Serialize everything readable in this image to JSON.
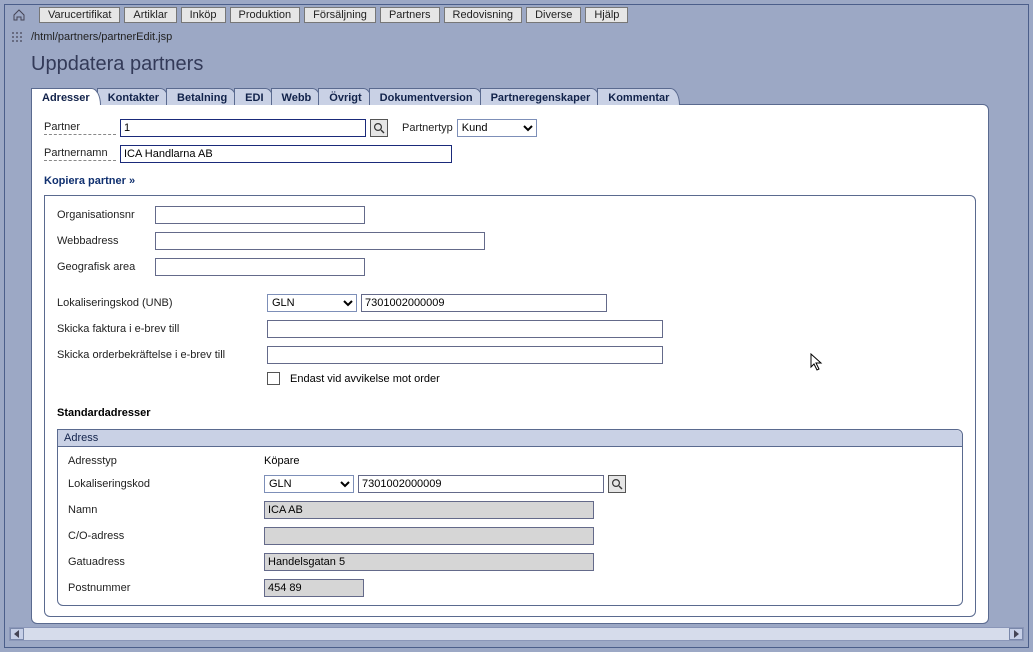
{
  "menu": {
    "items": [
      "Varucertifikat",
      "Artiklar",
      "Inköp",
      "Produktion",
      "Försäljning",
      "Partners",
      "Redovisning",
      "Diverse",
      "Hjälp"
    ]
  },
  "breadcrumb": "/html/partners/partnerEdit.jsp",
  "page_title": "Uppdatera partners",
  "tabs": [
    "Adresser",
    "Kontakter",
    "Betalning",
    "EDI",
    "Webb",
    "Övrigt",
    "Dokumentversion",
    "Partneregenskaper",
    "Kommentar"
  ],
  "active_tab": 0,
  "partner_block": {
    "partner_label": "Partner",
    "partner_value": "1",
    "partnertype_label": "Partnertyp",
    "partnertype_value": "Kund",
    "partnername_label": "Partnernamn",
    "partnername_value": "ICA Handlarna AB",
    "copy_link": "Kopiera partner »"
  },
  "details": {
    "orgnr_label": "Organisationsnr",
    "orgnr_value": "",
    "web_label": "Webbadress",
    "web_value": "",
    "geo_label": "Geografisk area",
    "geo_value": "",
    "unb_label": "Lokaliseringskod (UNB)",
    "unb_type": "GLN",
    "unb_value": "7301002000009",
    "invoice_email_label": "Skicka faktura i e-brev till",
    "invoice_email_value": "",
    "orderconf_email_label": "Skicka orderbekräftelse i e-brev till",
    "orderconf_email_value": "",
    "only_on_deviation_label": "Endast vid avvikelse mot order"
  },
  "std_addr_heading": "Standardadresser",
  "addr": {
    "panel_header": "Adress",
    "type_label": "Adresstyp",
    "type_value": "Köpare",
    "loc_label": "Lokaliseringskod",
    "loc_type": "GLN",
    "loc_value": "7301002000009",
    "name_label": "Namn",
    "name_value": "ICA AB",
    "co_label": "C/O-adress",
    "co_value": "",
    "street_label": "Gatuadress",
    "street_value": "Handelsgatan 5",
    "postal_label": "Postnummer",
    "postal_value": "454 89"
  }
}
